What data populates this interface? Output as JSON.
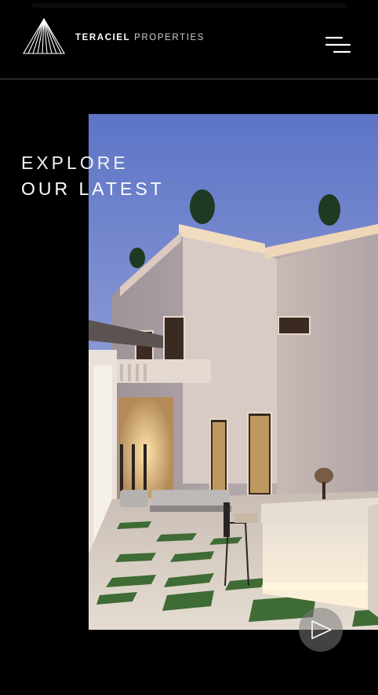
{
  "header": {
    "brand_bold": "TERACIEL",
    "brand_light": "PROPERTIES",
    "logo_icon": "triangle-logo-icon",
    "menu_icon": "hamburger-menu-icon"
  },
  "hero": {
    "headline_line1": "EXPLORE",
    "headline_line2": "OUR LATEST",
    "image_subject": "luxury villa exterior at dusk",
    "play_icon": "play-icon"
  },
  "colors": {
    "background": "#000000",
    "text": "#ffffff",
    "divider": "#4a4a4a",
    "play_button_bg": "#787878"
  }
}
